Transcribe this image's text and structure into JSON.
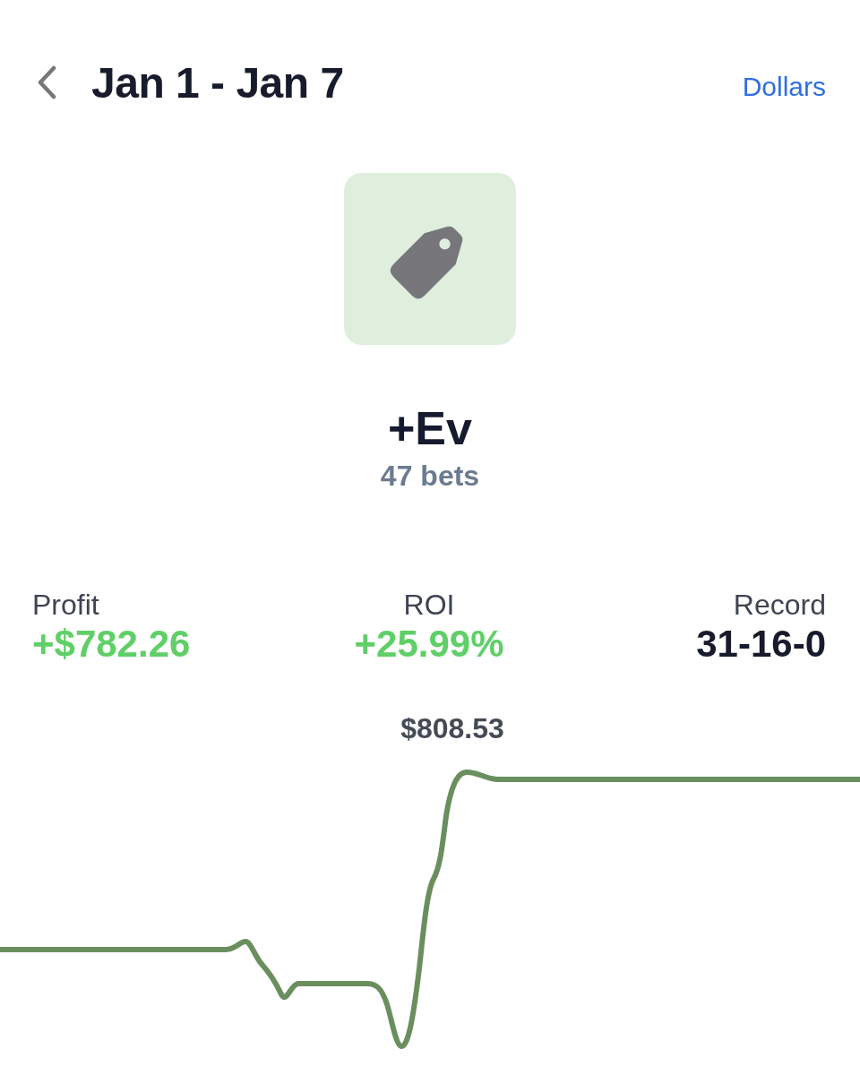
{
  "header": {
    "title": "Jan 1 - Jan 7",
    "unit_toggle": "Dollars"
  },
  "strategy": {
    "name": "+Ev",
    "bet_count": "47 bets"
  },
  "stats": [
    {
      "label": "Profit",
      "value": "+$782.26",
      "positive": true
    },
    {
      "label": "ROI",
      "value": "+25.99%",
      "positive": true
    },
    {
      "label": "Record",
      "value": "31-16-0",
      "positive": false
    }
  ],
  "chart": {
    "peak_label": "$808.53"
  }
}
